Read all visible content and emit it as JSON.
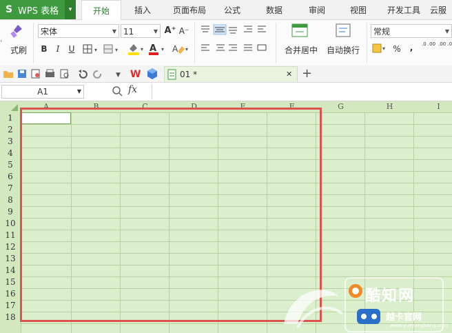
{
  "app": {
    "logo": "S",
    "title": "WPS 表格",
    "dropdown": "▾"
  },
  "menu_tabs": [
    "开始",
    "插入",
    "页面布局",
    "公式",
    "数据",
    "审阅",
    "视图",
    "开发工具",
    "云服"
  ],
  "ribbon": {
    "format_painter_label": "式刷",
    "font_name": "宋体",
    "font_size": "11",
    "bold": "B",
    "italic": "I",
    "underline": "U",
    "grow_font": "A⁺",
    "shrink_font": "A⁻",
    "merge_label": "合并居中",
    "wrap_label": "自动换行",
    "number_format": "常规",
    "percent": "%",
    "comma": ",",
    "inc_decimal": ".0 .00",
    "dec_decimal": ".00 .0"
  },
  "quick_bar": {
    "doc_tab": "01 *",
    "close": "✕",
    "new_tab": "+"
  },
  "formula_bar": {
    "cell_ref": "A1",
    "fx": "fx",
    "value": ""
  },
  "columns": [
    "A",
    "B",
    "C",
    "D",
    "E",
    "F",
    "G",
    "H",
    "I"
  ],
  "rows": [
    "1",
    "2",
    "3",
    "4",
    "5",
    "6",
    "7",
    "8",
    "9",
    "10",
    "11",
    "12",
    "13",
    "14",
    "15",
    "16",
    "17",
    "18"
  ],
  "watermark": {
    "brand": "酷知网",
    "brand2": "越卡官网",
    "url": "www.yueyangbang.com"
  },
  "colors": {
    "accent_green": "#3e9a3e",
    "grid_fill": "#dcefcc",
    "selection_red": "#d9534f"
  }
}
